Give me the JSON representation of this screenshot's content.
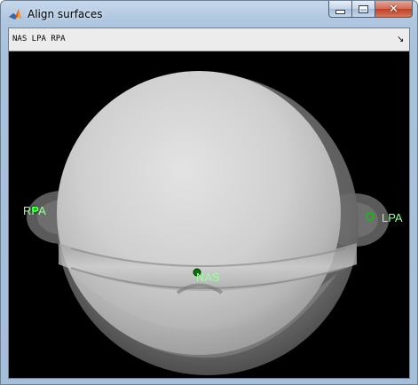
{
  "window": {
    "title": "Align surfaces",
    "close_glyph": "✕"
  },
  "toolbar": {
    "label": "NAS LPA RPA",
    "dock_glyph": "↘"
  },
  "fiducials": {
    "nas": "NAS",
    "lpa": "LPA",
    "rpa": "RPA"
  },
  "colors": {
    "fiducial_marker": "#00cc00",
    "fiducial_text": "#9cff9c",
    "background": "#000000",
    "surface": "#c8cac8"
  },
  "icons": {
    "app": "matlab-icon",
    "minimize": "minimize-icon",
    "maximize": "maximize-icon",
    "close": "close-icon",
    "dock": "dock-arrow-icon"
  }
}
